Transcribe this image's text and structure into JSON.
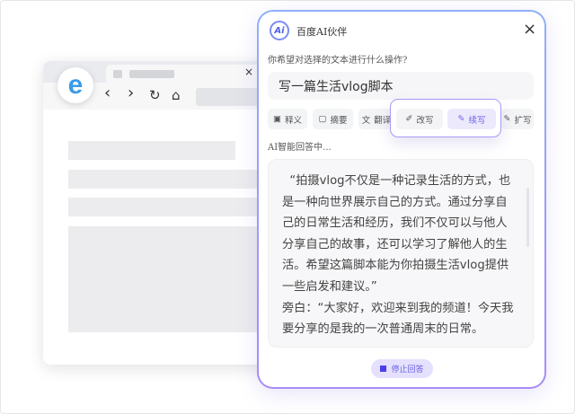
{
  "browser": {
    "tab_close": "×",
    "nav": {
      "back": "‹",
      "forward": "›",
      "reload": "↻",
      "home": "⌂"
    },
    "logo": "e"
  },
  "panel": {
    "logo": "Ai",
    "title": "百度AI伙伴",
    "close": "×",
    "question": "你希望对选择的文本进行什么操作?",
    "input_value": "写一篇生活vlog脚本",
    "actions": [
      {
        "label": "释义",
        "icon": "book-icon"
      },
      {
        "label": "摘要",
        "icon": "summary-icon"
      },
      {
        "label": "翻译",
        "icon": "translate-icon"
      },
      {
        "label": "改写",
        "icon": "rewrite-icon"
      },
      {
        "label": "续写",
        "icon": "pen-icon"
      },
      {
        "label": "扩写",
        "icon": "expand-icon"
      }
    ],
    "status": "AI智能回答中...",
    "answer_lines": [
      "  “拍摄vlog不仅是一种记录生活的方式，也是一种向世界展示自己的方式。通过分享自己的日常生活和经历，我们不仅可以与他人分享自己的故事，还可以学习了解他人的生活。希望这篇脚本能为你拍摄生活vlog提供一些启发和建议。”",
      "旁白：“大家好，欢迎来到我的频道！今天我要分享的是我的一次普通周末的日常。"
    ],
    "stop_label": "停止回答",
    "accent": "#4a3ff0"
  }
}
